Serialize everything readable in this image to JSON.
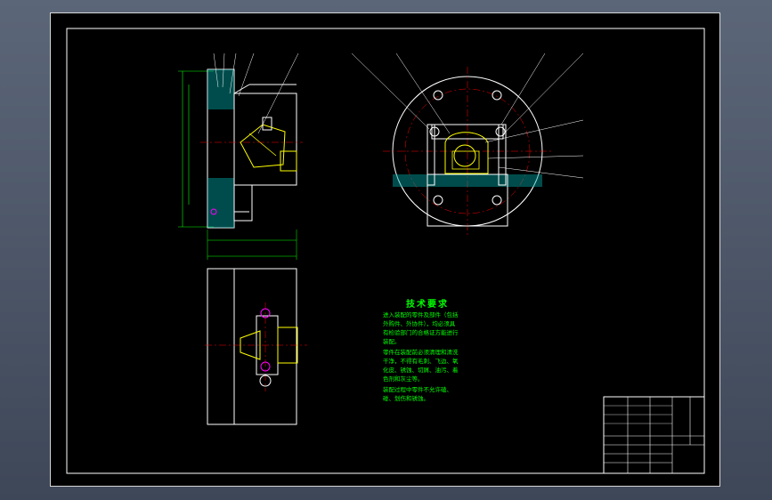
{
  "notes": {
    "title": "技术要求",
    "lines": [
      "进入装配的零件及部件（包括",
      "外购件、外协件），均必须具",
      "有检验部门的合格证方能进行",
      "装配。",
      "零件在装配前必须清理和清洗",
      "干净，不得有毛刺、飞边、氧",
      "化皮、锈蚀、切屑、油污、着",
      "色剂和灰尘等。",
      "装配过程中零件不允许磕、",
      "碰、划伤和锈蚀。"
    ]
  },
  "colors": {
    "frame": "#d8d8d8",
    "outline": "#ffffff",
    "dimension": "#00ff00",
    "part": "#ffff00",
    "center": "#ff0000",
    "hatch": "#00a8a8",
    "bolt": "#ff00ff"
  }
}
